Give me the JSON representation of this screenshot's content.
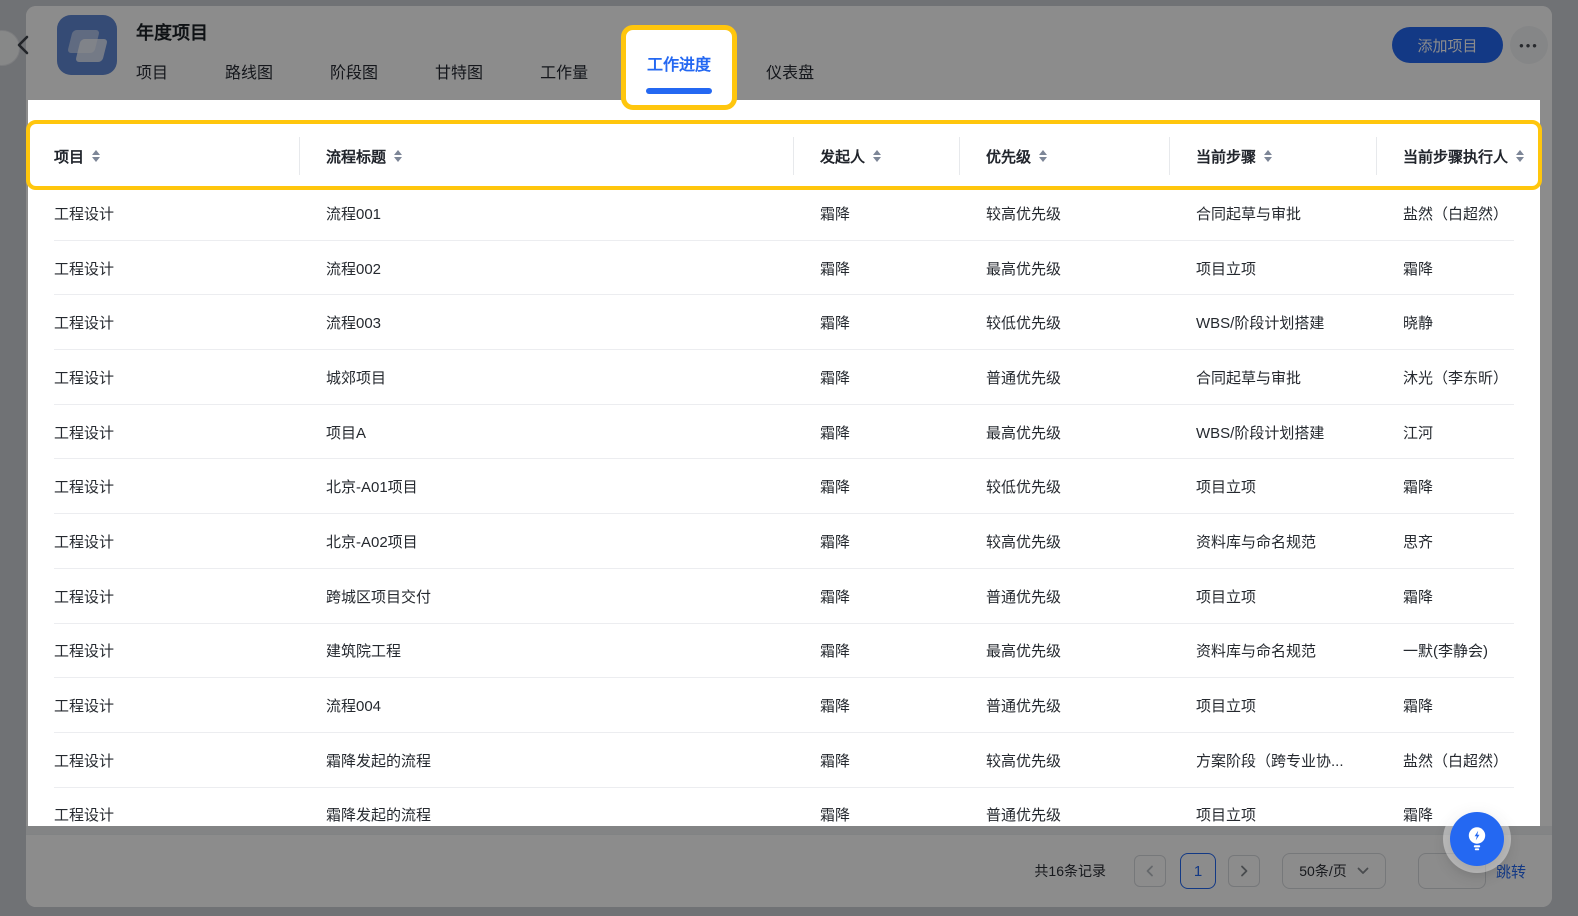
{
  "header": {
    "title": "年度项目",
    "tabs": [
      {
        "label": "项目",
        "active": false
      },
      {
        "label": "路线图",
        "active": false
      },
      {
        "label": "阶段图",
        "active": false
      },
      {
        "label": "甘特图",
        "active": false
      },
      {
        "label": "工作量",
        "active": false
      },
      {
        "label": "工作进度",
        "active": true
      },
      {
        "label": "仪表盘",
        "active": false
      }
    ],
    "add_button_label": "添加项目",
    "more_button_label": "•••"
  },
  "table": {
    "columns": [
      "项目",
      "流程标题",
      "发起人",
      "优先级",
      "当前步骤",
      "当前步骤执行人"
    ],
    "sortable": true,
    "rows": [
      [
        "工程设计",
        "流程001",
        "霜降",
        "较高优先级",
        "合同起草与审批",
        "盐然（白超然）"
      ],
      [
        "工程设计",
        "流程002",
        "霜降",
        "最高优先级",
        "项目立项",
        "霜降"
      ],
      [
        "工程设计",
        "流程003",
        "霜降",
        "较低优先级",
        "WBS/阶段计划搭建",
        "晓静"
      ],
      [
        "工程设计",
        "城郊项目",
        "霜降",
        "普通优先级",
        "合同起草与审批",
        "沐光（李东昕）"
      ],
      [
        "工程设计",
        "项目A",
        "霜降",
        "最高优先级",
        "WBS/阶段计划搭建",
        "江河"
      ],
      [
        "工程设计",
        "北京-A01项目",
        "霜降",
        "较低优先级",
        "项目立项",
        "霜降"
      ],
      [
        "工程设计",
        "北京-A02项目",
        "霜降",
        "较高优先级",
        "资料库与命名规范",
        "思齐"
      ],
      [
        "工程设计",
        "跨城区项目交付",
        "霜降",
        "普通优先级",
        "项目立项",
        "霜降"
      ],
      [
        "工程设计",
        "建筑院工程",
        "霜降",
        "最高优先级",
        "资料库与命名规范",
        "一默(李静会)"
      ],
      [
        "工程设计",
        "流程004",
        "霜降",
        "普通优先级",
        "项目立项",
        "霜降"
      ],
      [
        "工程设计",
        "霜降发起的流程",
        "霜降",
        "较高优先级",
        "方案阶段（跨专业协...",
        "盐然（白超然）"
      ],
      [
        "工程设计",
        "霜降发起的流程",
        "霜降",
        "普通优先级",
        "项目立项",
        "霜降"
      ]
    ]
  },
  "pagination": {
    "total_label": "共16条记录",
    "current_page": "1",
    "page_size_label": "50条/页",
    "jump_input_value": "",
    "jump_label": "跳转"
  },
  "icons": {
    "back": "chevron-left",
    "app_logo": "overlapping-cards",
    "more": "ellipsis",
    "sort": "up-down-arrows",
    "prev_page": "chevron-left",
    "next_page": "chevron-right",
    "page_size_dropdown": "chevron-down",
    "help": "lightbulb"
  },
  "colors": {
    "primary_blue": "#2468f2",
    "tour_highlight_yellow": "#ffc60d",
    "dim_overlay": "rgba(0,0,0,0.45)"
  }
}
